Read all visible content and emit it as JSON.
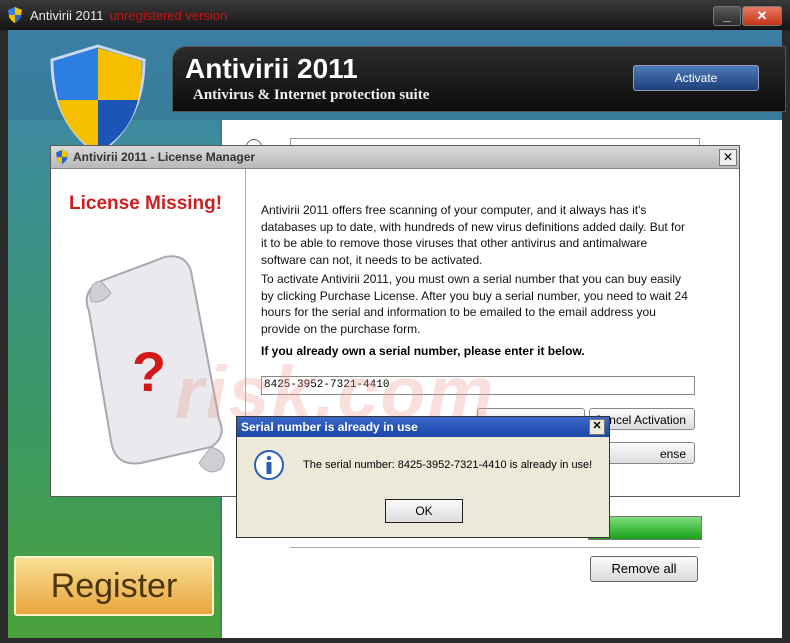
{
  "window": {
    "title": "Antivirii 2011",
    "title_suffix": "unregistered version",
    "minimize": "_",
    "close": "✕"
  },
  "banner": {
    "title": "Antivirii 2011",
    "subtitle": "Antivirus & Internet protection suite",
    "activate_label": "Activate"
  },
  "main": {
    "remove_all_label": "Remove all",
    "register_label": "Register"
  },
  "license_manager": {
    "title": "Antivirii 2011 - License Manager",
    "close": "✕",
    "license_missing": "License Missing!",
    "paragraph1": "Antivirii 2011 offers free scanning of your computer, and it always has it's databases up to date, with hundreds of new virus definitions added daily. But for it to be able to remove those viruses that other antivirus and antimalware software can not, it needs to be activated.",
    "paragraph2": "To activate Antivirii 2011, you must own a serial number that you can buy easily by clicking Purchase License. After you buy a serial number, you need to wait 24 hours for the serial and information to be emailed to the email address you provide on the purchase form.",
    "prompt": "If you already own a serial number, please enter it below.",
    "serial_value": "8425-3952-7321-4410",
    "btn_cancel_activation": "Cancel Activation",
    "btn_purchase_partial": "ense"
  },
  "dialog": {
    "title": "Serial number is already in use",
    "close": "✕",
    "message": "The serial number: 8425-3952-7321-4410 is already in use!",
    "ok_label": "OK"
  },
  "watermark": "risk.com",
  "colors": {
    "accent_red": "#cc1f1f",
    "dialog_title": "#1b45a8",
    "register_gold": "#e9a53c"
  }
}
